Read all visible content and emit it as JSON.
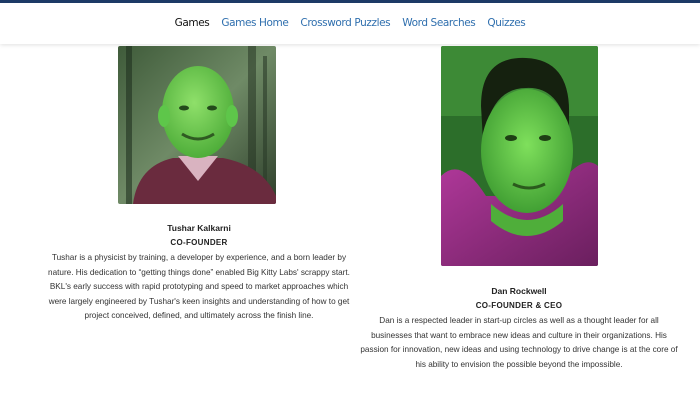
{
  "nav": {
    "items": [
      {
        "label": "Games",
        "active": true
      },
      {
        "label": "Games Home",
        "active": false
      },
      {
        "label": "Crossword Puzzles",
        "active": false
      },
      {
        "label": "Word Searches",
        "active": false
      },
      {
        "label": "Quizzes",
        "active": false
      }
    ]
  },
  "team": [
    {
      "name": "Tushar Kalkarni",
      "role": "CO-FOUNDER",
      "bio": "Tushar is a physicist by training, a developer by experience, and a born leader by nature. His dedication to “getting things done” enabled Big Kitty Labs' scrappy start. BKL's early success with rapid prototyping and speed to market approaches which were largely engineered by Tushar's keen insights and understanding of how to get project conceived, defined, and ultimately across the finish line."
    },
    {
      "name": "Dan Rockwell",
      "role": "CO-FOUNDER & CEO",
      "bio": "Dan is a respected leader in start-up circles as well as a thought leader for all businesses that want to embrace new ideas and culture in their organizations. His passion for innovation, new ideas and using technology to drive change is at the core of his ability to envision the possible beyond the impossible."
    }
  ],
  "colors": {
    "nav_link": "#2f6fae",
    "nav_active": "#111111",
    "topbar_border": "#1d3a66",
    "photo_tint_green": "#5cd15a",
    "photo_tint_magenta": "#8a2e7a"
  }
}
